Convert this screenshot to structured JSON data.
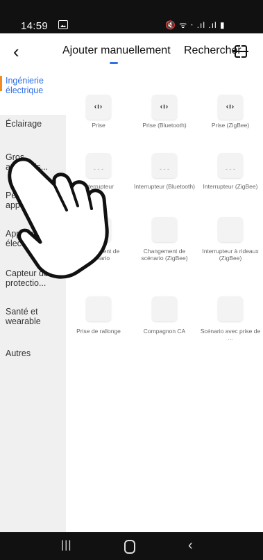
{
  "status_bar": {
    "time": "14:59",
    "right_icons": "🔇 ᯤ ‧ .ıl .ıl ▮"
  },
  "header": {
    "back_icon": "‹",
    "tab_add_manually": "Ajouter manuellement",
    "tab_search": "Rechercher",
    "scan_icon": "scan-icon",
    "accent": "#2f6fe8"
  },
  "sidebar": {
    "items": [
      {
        "label": "Ingénierie électrique"
      },
      {
        "label": "Éclairage"
      },
      {
        "label": "Gros appareils..."
      },
      {
        "label": "Petits appareils..."
      },
      {
        "label": "Appareils électrom..."
      },
      {
        "label": "Capteur de protectio..."
      },
      {
        "label": "Santé et wearable"
      },
      {
        "label": "Autres"
      }
    ],
    "active_index": 0,
    "active_bar_color": "#f08c23"
  },
  "grid": {
    "items": [
      {
        "caption": "Prise",
        "icon": "socket-icon"
      },
      {
        "caption": "Prise (Bluetooth)",
        "icon": "socket-icon"
      },
      {
        "caption": "Prise (ZigBee)",
        "icon": "socket-icon"
      },
      {
        "caption": "Interrupteur",
        "icon": "switch-icon"
      },
      {
        "caption": "Interrupteur (Bluetooth)",
        "icon": "switch-icon"
      },
      {
        "caption": "Interrupteur (ZigBee)",
        "icon": "switch-icon"
      },
      {
        "caption": "Changement de scénario",
        "icon": "scene-switch-icon"
      },
      {
        "caption": "Changement de scénario (ZigBee)",
        "icon": "scene-switch-icon"
      },
      {
        "caption": "Interrupteur à rideaux (ZigBee)",
        "icon": "curtain-switch-icon"
      },
      {
        "caption": "Prise de rallonge",
        "icon": "power-strip-icon"
      },
      {
        "caption": "Compagnon CA",
        "icon": "ac-companion-icon"
      },
      {
        "caption": "Scénario avec prise de ...",
        "icon": "lamp-icon"
      }
    ]
  },
  "nav_bar": {
    "recent": "|||",
    "back": "‹"
  }
}
